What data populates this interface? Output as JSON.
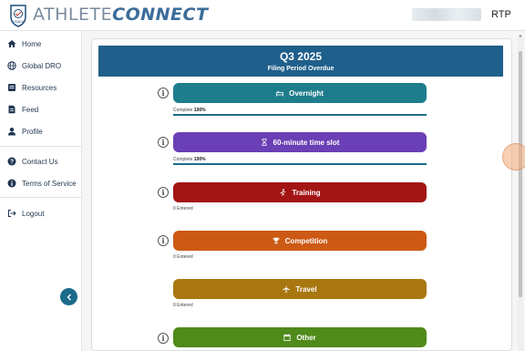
{
  "app": {
    "logo_badge_text": "USADA",
    "brand_light": "ATHLETE",
    "brand_bold": "CONNECT",
    "user_initials": "RTP"
  },
  "sidebar": {
    "items": [
      {
        "label": "Home",
        "icon": "home-icon"
      },
      {
        "label": "Global DRO",
        "icon": "globe-icon"
      },
      {
        "label": "Resources",
        "icon": "book-icon"
      },
      {
        "label": "Feed",
        "icon": "document-icon"
      },
      {
        "label": "Profile",
        "icon": "user-icon"
      }
    ],
    "support_items": [
      {
        "label": "Contact Us",
        "icon": "question-icon"
      },
      {
        "label": "Terms of Service",
        "icon": "info-circle-icon"
      }
    ],
    "logout_label": "Logout",
    "collapse_icon": "chevron-left-icon"
  },
  "header": {
    "title": "Q3 2025",
    "subtitle": "Filing Period Overdue",
    "color": "#1f5f8b"
  },
  "categories": [
    {
      "label": "Overnight",
      "icon": "bed-icon",
      "color": "#1e7d8c",
      "status_label": "Complete",
      "status_value": "100%",
      "progress": 1.0
    },
    {
      "label": "60-minute time slot",
      "icon": "hourglass-icon",
      "color": "#6b3fb5",
      "status_label": "Complete",
      "status_value": "100%",
      "progress": 1.0
    },
    {
      "label": "Training",
      "icon": "running-icon",
      "color": "#a31515",
      "status_label": "",
      "status_value": "0 Entered"
    },
    {
      "label": "Competition",
      "icon": "trophy-icon",
      "color": "#cc5a14",
      "status_label": "",
      "status_value": "0 Entered"
    },
    {
      "label": "Travel",
      "icon": "plane-icon",
      "color": "#a8770f",
      "status_label": "",
      "status_value": "0 Entered"
    },
    {
      "label": "Other",
      "icon": "calendar-icon",
      "color": "#4f8a1b",
      "status_label": "",
      "status_value": ""
    }
  ]
}
